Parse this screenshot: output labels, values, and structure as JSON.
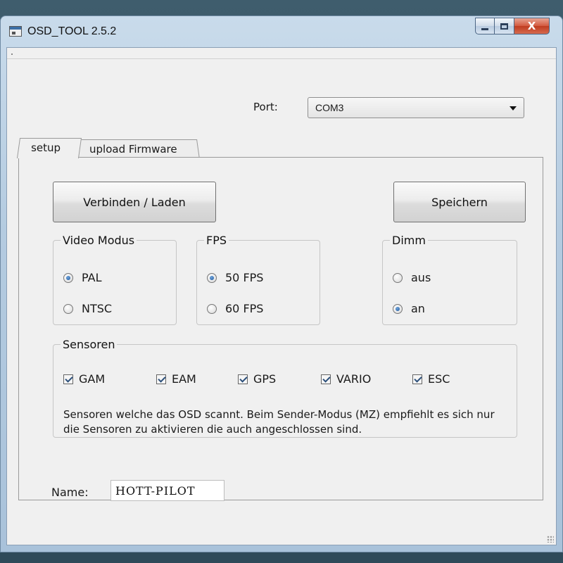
{
  "window": {
    "title": "OSD_TOOL 2.5.2",
    "close_glyph": "X"
  },
  "port": {
    "label": "Port:",
    "selected": "COM3"
  },
  "tabs": [
    {
      "label": "setup",
      "active": true
    },
    {
      "label": "upload Firmware",
      "active": false
    }
  ],
  "buttons": {
    "connect": "Verbinden / Laden",
    "save": "Speichern"
  },
  "video_mode": {
    "legend": "Video Modus",
    "options": [
      {
        "label": "PAL",
        "selected": true
      },
      {
        "label": "NTSC",
        "selected": false
      }
    ]
  },
  "fps": {
    "legend": "FPS",
    "options": [
      {
        "label": "50 FPS",
        "selected": true
      },
      {
        "label": "60 FPS",
        "selected": false
      }
    ]
  },
  "dimm": {
    "legend": "Dimm",
    "options": [
      {
        "label": "aus",
        "selected": false
      },
      {
        "label": "an",
        "selected": true
      }
    ]
  },
  "sensors": {
    "legend": "Sensoren",
    "items": [
      {
        "label": "GAM",
        "checked": true
      },
      {
        "label": "EAM",
        "checked": true
      },
      {
        "label": "GPS",
        "checked": true
      },
      {
        "label": "VARIO",
        "checked": true
      },
      {
        "label": "ESC",
        "checked": true
      }
    ],
    "note": "Sensoren welche das OSD scannt. Beim Sender-Modus (MZ) empfiehlt es sich nur die Sensoren zu aktivieren die auch angeschlossen sind."
  },
  "name": {
    "label": "Name:",
    "value": "HOTT-PILOT"
  }
}
